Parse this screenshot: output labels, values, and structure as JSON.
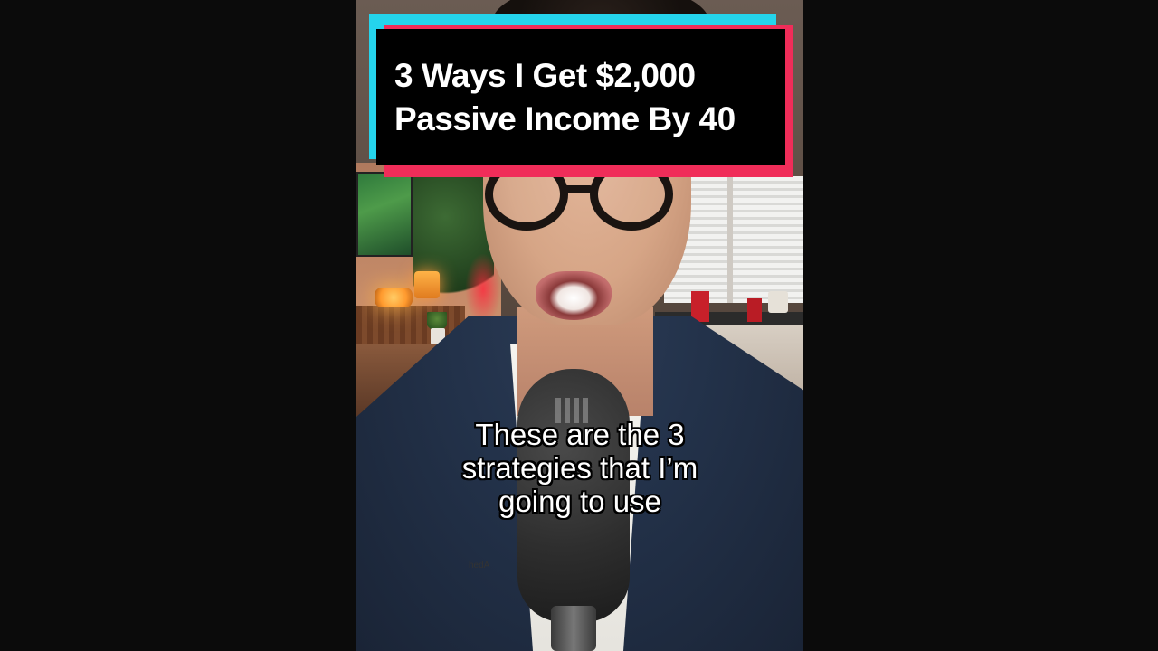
{
  "video": {
    "title_card": {
      "line1": "3 Ways I Get $2,000",
      "line2": "Passive Income By 40"
    },
    "caption": {
      "line1": "These are the 3",
      "line2": "strategies that I’m",
      "line3": "going to use"
    },
    "shirt_text": "hedA",
    "colors": {
      "background": "#0b0b0b",
      "title_box": "#000000",
      "title_accent_cyan": "#25d4ec",
      "title_accent_pink": "#f02d59",
      "caption_text": "#ffffff"
    }
  }
}
